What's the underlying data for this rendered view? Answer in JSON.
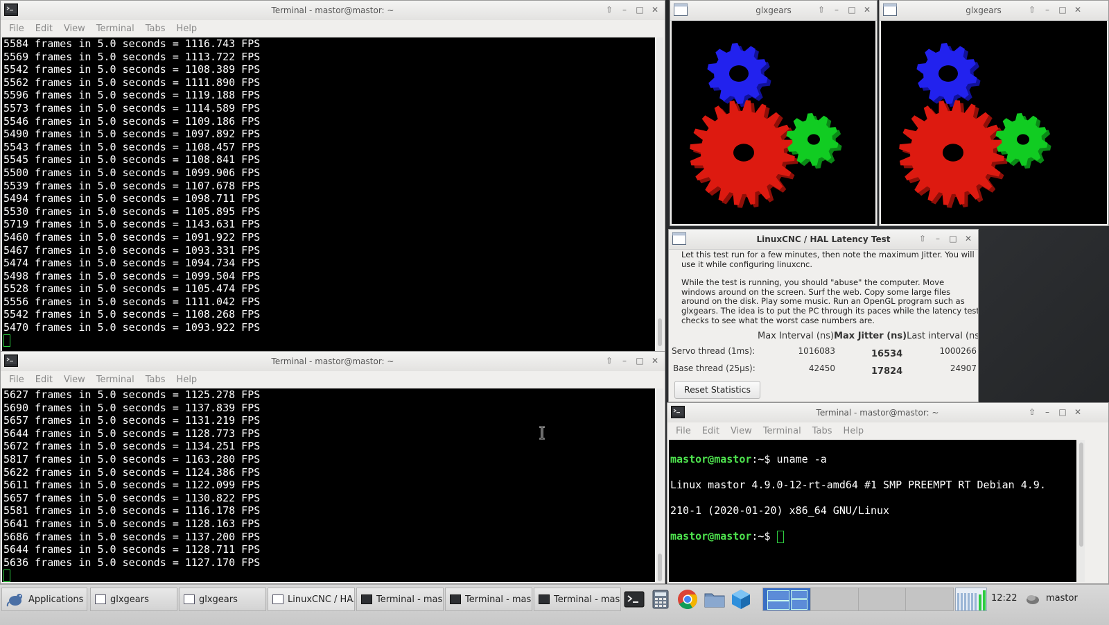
{
  "menu_labels": [
    "File",
    "Edit",
    "View",
    "Terminal",
    "Tabs",
    "Help"
  ],
  "term_top": {
    "title": "Terminal - mastor@mastor: ~",
    "lines": [
      "5584 frames in 5.0 seconds = 1116.743 FPS",
      "5569 frames in 5.0 seconds = 1113.722 FPS",
      "5542 frames in 5.0 seconds = 1108.389 FPS",
      "5562 frames in 5.0 seconds = 1111.890 FPS",
      "5596 frames in 5.0 seconds = 1119.188 FPS",
      "5573 frames in 5.0 seconds = 1114.589 FPS",
      "5546 frames in 5.0 seconds = 1109.186 FPS",
      "5490 frames in 5.0 seconds = 1097.892 FPS",
      "5543 frames in 5.0 seconds = 1108.457 FPS",
      "5545 frames in 5.0 seconds = 1108.841 FPS",
      "5500 frames in 5.0 seconds = 1099.906 FPS",
      "5539 frames in 5.0 seconds = 1107.678 FPS",
      "5494 frames in 5.0 seconds = 1098.711 FPS",
      "5530 frames in 5.0 seconds = 1105.895 FPS",
      "5719 frames in 5.0 seconds = 1143.631 FPS",
      "5460 frames in 5.0 seconds = 1091.922 FPS",
      "5467 frames in 5.0 seconds = 1093.331 FPS",
      "5474 frames in 5.0 seconds = 1094.734 FPS",
      "5498 frames in 5.0 seconds = 1099.504 FPS",
      "5528 frames in 5.0 seconds = 1105.474 FPS",
      "5556 frames in 5.0 seconds = 1111.042 FPS",
      "5542 frames in 5.0 seconds = 1108.268 FPS",
      "5470 frames in 5.0 seconds = 1093.922 FPS"
    ]
  },
  "term_bottom": {
    "title": "Terminal - mastor@mastor: ~",
    "lines": [
      "5627 frames in 5.0 seconds = 1125.278 FPS",
      "5690 frames in 5.0 seconds = 1137.839 FPS",
      "5657 frames in 5.0 seconds = 1131.219 FPS",
      "5644 frames in 5.0 seconds = 1128.773 FPS",
      "5672 frames in 5.0 seconds = 1134.251 FPS",
      "5817 frames in 5.0 seconds = 1163.280 FPS",
      "5622 frames in 5.0 seconds = 1124.386 FPS",
      "5611 frames in 5.0 seconds = 1122.099 FPS",
      "5657 frames in 5.0 seconds = 1130.822 FPS",
      "5581 frames in 5.0 seconds = 1116.178 FPS",
      "5641 frames in 5.0 seconds = 1128.163 FPS",
      "5686 frames in 5.0 seconds = 1137.200 FPS",
      "5644 frames in 5.0 seconds = 1128.711 FPS",
      "5636 frames in 5.0 seconds = 1127.170 FPS"
    ]
  },
  "glx1": {
    "title": "glxgears"
  },
  "glx2": {
    "title": "glxgears"
  },
  "latency": {
    "title": "LinuxCNC / HAL Latency Test",
    "para1": "Let this test run for a few minutes, then note the maximum Jitter.  You will use it while configuring linuxcnc.",
    "para2": "While the test is running, you should \"abuse\" the computer. Move windows around on the screen. Surf the web. Copy some large files around on the disk. Play some music. Run an OpenGL program such as glxgears. The idea is to put the PC through its paces while the latency test checks to see what the worst case numbers are.",
    "col_max_interval": "Max Interval (ns)",
    "col_max_jitter": "Max Jitter (ns)",
    "col_last_interval": "Last interval (ns)",
    "rows": [
      {
        "label": "Servo thread (1ms):",
        "max_interval": "1016083",
        "max_jitter": "16534",
        "last_interval": "1000266"
      },
      {
        "label": "Base thread (25µs):",
        "max_interval": "42450",
        "max_jitter": "17824",
        "last_interval": "24907"
      }
    ],
    "reset_label": "Reset Statistics"
  },
  "term_right": {
    "title": "Terminal - mastor@mastor: ~",
    "prompt1": "mastor@mastor",
    "suffix1": ":~$ ",
    "cmd1": "uname -a",
    "out1": "Linux mastor 4.9.0-12-rt-amd64 #1 SMP PREEMPT RT Debian 4.9.",
    "out2": "210-1 (2020-01-20) x86_64 GNU/Linux",
    "prompt2": "mastor@mastor",
    "suffix2": ":~$ "
  },
  "taskbar": {
    "applications": "Applications",
    "tasks": [
      "glxgears",
      "glxgears",
      "LinuxCNC / HA...",
      "Terminal - mas...",
      "Terminal - mas...",
      "Terminal - mas..."
    ],
    "clock": "12:22",
    "user": "mastor"
  }
}
